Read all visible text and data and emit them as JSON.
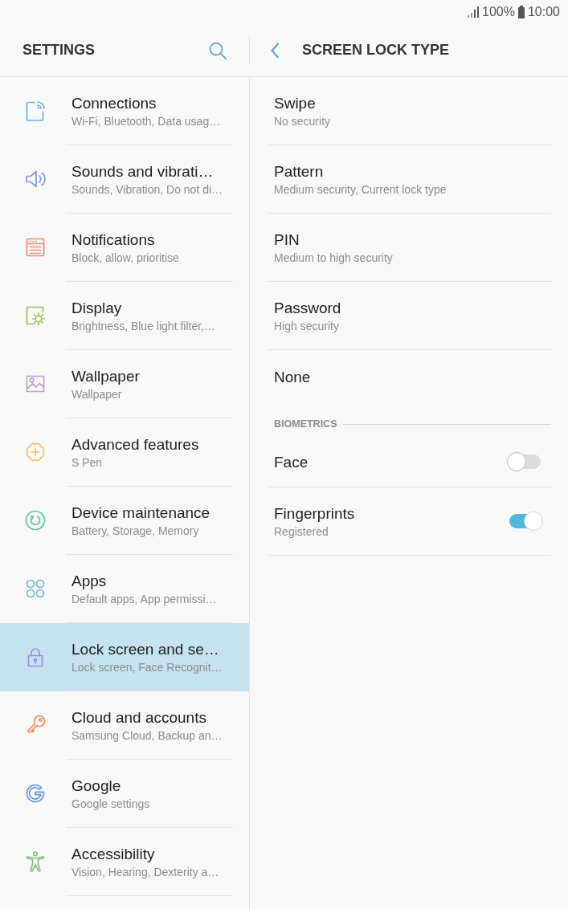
{
  "status_bar": {
    "battery": "100%",
    "time": "10:00"
  },
  "settings_header": {
    "title": "SETTINGS"
  },
  "detail_header": {
    "title": "SCREEN LOCK TYPE"
  },
  "sidebar": {
    "items": [
      {
        "title": "Connections",
        "subtitle": "Wi-Fi, Bluetooth, Data usag…",
        "color": "#6aaee0",
        "selected": false
      },
      {
        "title": "Sounds and vibrati…",
        "subtitle": "Sounds, Vibration, Do not di…",
        "color": "#7f97e2",
        "selected": false
      },
      {
        "title": "Notifications",
        "subtitle": "Block, allow, prioritise",
        "color": "#ee8a80",
        "selected": false
      },
      {
        "title": "Display",
        "subtitle": "Brightness, Blue light filter,…",
        "color": "#9cc064",
        "selected": false
      },
      {
        "title": "Wallpaper",
        "subtitle": "Wallpaper",
        "color": "#c79ada",
        "selected": false
      },
      {
        "title": "Advanced features",
        "subtitle": "S Pen",
        "color": "#efc062",
        "selected": false
      },
      {
        "title": "Device maintenance",
        "subtitle": "Battery, Storage, Memory",
        "color": "#5fc4a6",
        "selected": false
      },
      {
        "title": "Apps",
        "subtitle": "Default apps, App permissi…",
        "color": "#6bb5de",
        "selected": false
      },
      {
        "title": "Lock screen and se…",
        "subtitle": "Lock screen, Face Recognit…",
        "color": "#9a8ee2",
        "selected": true
      },
      {
        "title": "Cloud and accounts",
        "subtitle": "Samsung Cloud, Backup an…",
        "color": "#f0915c",
        "selected": false
      },
      {
        "title": "Google",
        "subtitle": "Google settings",
        "color": "#6a92e0",
        "selected": false
      },
      {
        "title": "Accessibility",
        "subtitle": "Vision, Hearing, Dexterity a…",
        "color": "#86c47a",
        "selected": false
      }
    ]
  },
  "lock_types": [
    {
      "title": "Swipe",
      "subtitle": "No security"
    },
    {
      "title": "Pattern",
      "subtitle": "Medium security, Current lock type"
    },
    {
      "title": "PIN",
      "subtitle": "Medium to high security"
    },
    {
      "title": "Password",
      "subtitle": "High security"
    },
    {
      "title": "None"
    }
  ],
  "biometrics": {
    "heading": "BIOMETRICS",
    "items": [
      {
        "title": "Face",
        "on": false
      },
      {
        "title": "Fingerprints",
        "subtitle": "Registered",
        "on": true
      }
    ]
  }
}
